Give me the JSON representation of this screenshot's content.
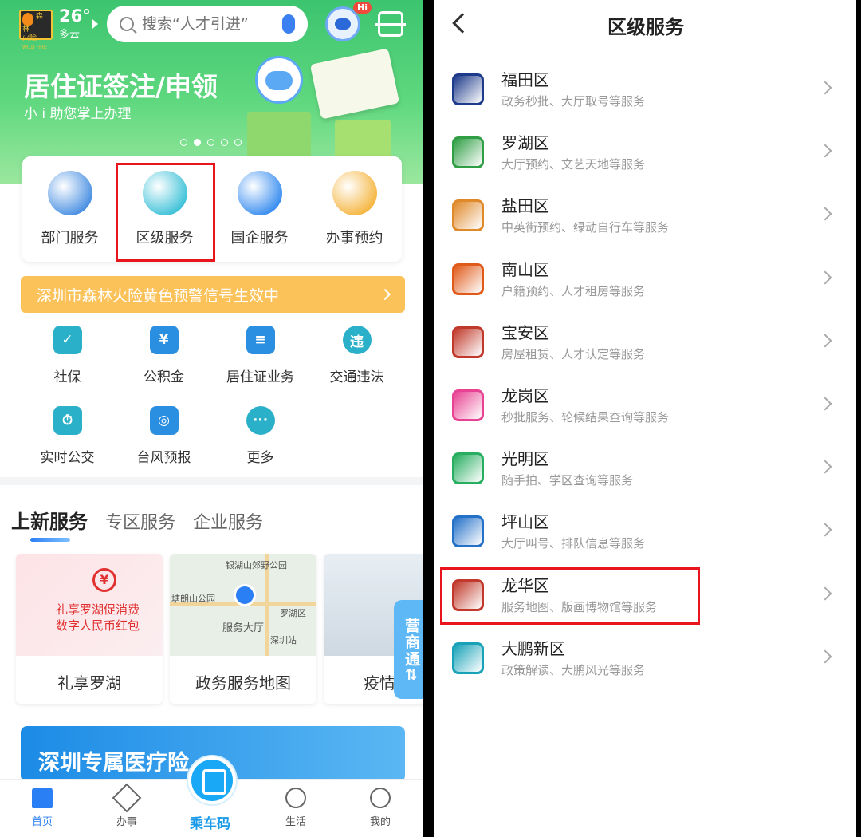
{
  "left": {
    "fire_sign": {
      "line1": "森林",
      "line2": "火险",
      "tag": "WILD FIRE"
    },
    "weather": {
      "temp": "26°",
      "desc": "多云"
    },
    "search": {
      "placeholder": "搜索“人才引进”"
    },
    "assistant_badge": "Hi",
    "hero": {
      "title": "居住证签注/申领",
      "subtitle": "小 i 助您掌上办理"
    },
    "services": [
      {
        "label": "部门服务",
        "color": "#4a90e2"
      },
      {
        "label": "区级服务",
        "color": "#3fc2d8"
      },
      {
        "label": "国企服务",
        "color": "#3a8ef0"
      },
      {
        "label": "办事预约",
        "color": "#f5b642"
      }
    ],
    "warning": "深圳市森林火险黄色预警信号生效中",
    "grid": [
      {
        "label": "社保",
        "color": "#2ab0c8",
        "glyph": "✓"
      },
      {
        "label": "公积金",
        "color": "#2a8fe0",
        "glyph": "¥"
      },
      {
        "label": "居住证业务",
        "color": "#2a8fe0",
        "glyph": "≡"
      },
      {
        "label": "交通违法",
        "color": "#2ab0c8",
        "glyph": "违"
      },
      {
        "label": "实时公交",
        "color": "#2ab0c8",
        "glyph": "⏱"
      },
      {
        "label": "台风预报",
        "color": "#2a8fe0",
        "glyph": "◎"
      },
      {
        "label": "更多",
        "color": "#2ab0c8",
        "glyph": "···"
      }
    ],
    "tabs": [
      "上新服务",
      "专区服务",
      "企业服务"
    ],
    "cards": [
      {
        "title": "礼享罗湖",
        "promo1": "礼享罗湖促消费",
        "promo2": "数字人民币红包"
      },
      {
        "title": "政务服务地图",
        "map1": "银湖山郊野公园",
        "map2": "塘朗山公园",
        "map3": "服务大厅",
        "map4": "罗湖区",
        "map5": "深圳站"
      },
      {
        "title": "疫情"
      }
    ],
    "side_tab": "营商通",
    "side_arrow": "⇄",
    "medical_banner": "深圳专属医疗险",
    "nav": [
      "首页",
      "办事",
      "乘车码",
      "生活",
      "我的"
    ]
  },
  "right": {
    "title": "区级服务",
    "districts": [
      {
        "name": "福田区",
        "desc": "政务秒批、大厅取号等服务",
        "color": "#1e3a8a"
      },
      {
        "name": "罗湖区",
        "desc": "大厅预约、文艺天地等服务",
        "color": "#2f9e44"
      },
      {
        "name": "盐田区",
        "desc": "中英街预约、绿动自行车等服务",
        "color": "#e0892a"
      },
      {
        "name": "南山区",
        "desc": "户籍预约、人才租房等服务",
        "color": "#e05a1a"
      },
      {
        "name": "宝安区",
        "desc": "房屋租赁、人才认定等服务",
        "color": "#c0392b"
      },
      {
        "name": "龙岗区",
        "desc": "秒批服务、轮候结果查询等服务",
        "color": "#e84393"
      },
      {
        "name": "光明区",
        "desc": "随手拍、学区查询等服务",
        "color": "#27ae60"
      },
      {
        "name": "坪山区",
        "desc": "大厅叫号、排队信息等服务",
        "color": "#2471c8"
      },
      {
        "name": "龙华区",
        "desc": "服务地图、版画博物馆等服务",
        "color": "#c0392b"
      },
      {
        "name": "大鹏新区",
        "desc": "政策解读、大鹏风光等服务",
        "color": "#17a2b8"
      }
    ]
  }
}
